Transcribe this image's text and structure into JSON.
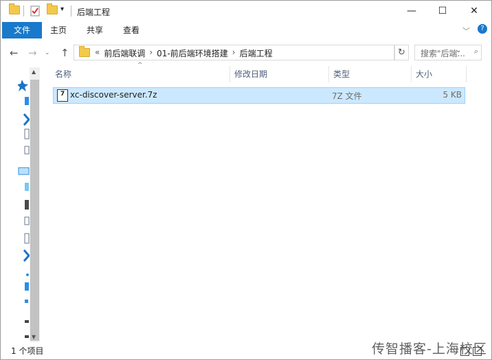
{
  "window": {
    "title": "后端工程",
    "minimize_icon": "minimize-icon",
    "maximize_icon": "maximize-icon",
    "close_icon": "close-icon"
  },
  "ribbon": {
    "tabs": [
      "文件",
      "主页",
      "共享",
      "查看"
    ],
    "expand_icon": "chevron-down-icon",
    "help_icon": "help-icon"
  },
  "address": {
    "overflow": "«",
    "crumbs": [
      "前后端联调",
      "01-前后端环境搭建",
      "后端工程"
    ],
    "separator": "›",
    "search_placeholder": "搜索\"后端..."
  },
  "columns": [
    "名称",
    "修改日期",
    "类型",
    "大小"
  ],
  "files": [
    {
      "name": "xc-discover-server.7z",
      "modified": "",
      "type": "7Z 文件",
      "size": "5 KB",
      "icon": "7z-archive-icon"
    }
  ],
  "status": {
    "item_count": "1 个项目"
  },
  "watermark": "传智播客-上海校区",
  "colors": {
    "file_tab": "#1979ca",
    "selection_bg": "#cce8ff",
    "selection_border": "#99d1ff",
    "header_text": "#4c607a"
  }
}
